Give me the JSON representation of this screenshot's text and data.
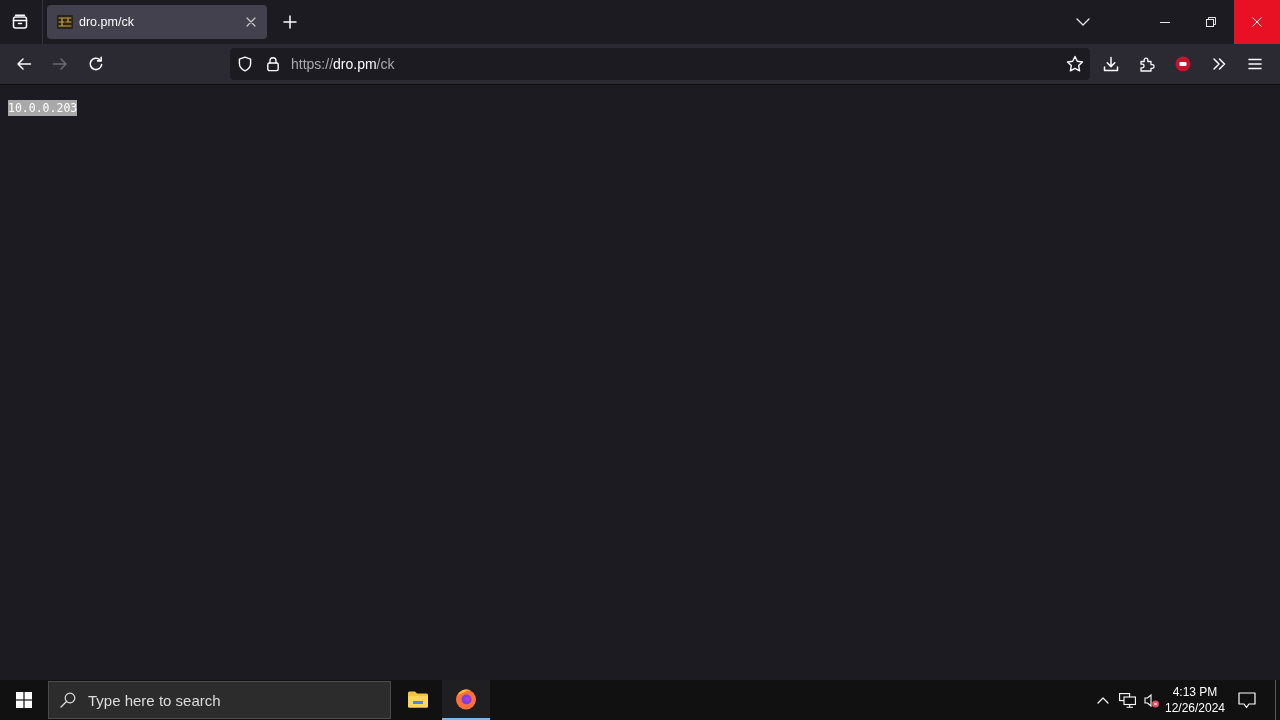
{
  "window": {
    "controls": [
      {
        "kind": "minimize",
        "hovered": false
      },
      {
        "kind": "restore",
        "hovered": false
      },
      {
        "kind": "close",
        "hovered": true
      }
    ]
  },
  "tabs": [
    {
      "title": "dro.pm/ck",
      "selected": true
    }
  ],
  "toolbar": {
    "back": {
      "disabled": false
    },
    "forward": {
      "disabled": true
    },
    "url": {
      "scheme": "https://",
      "host": "dro.pm",
      "path": "/ck"
    }
  },
  "page": {
    "text": "10.0.0.203",
    "selected": true
  },
  "taskbar": {
    "search": {
      "placeholder": "Type here to search"
    },
    "apps": [
      {
        "kind": "file-explorer",
        "active": false
      },
      {
        "kind": "browser",
        "active": true
      }
    ],
    "tray": {
      "volume_muted": true
    },
    "clock": {
      "time": "4:13 PM",
      "date": "12/26/2024"
    }
  }
}
